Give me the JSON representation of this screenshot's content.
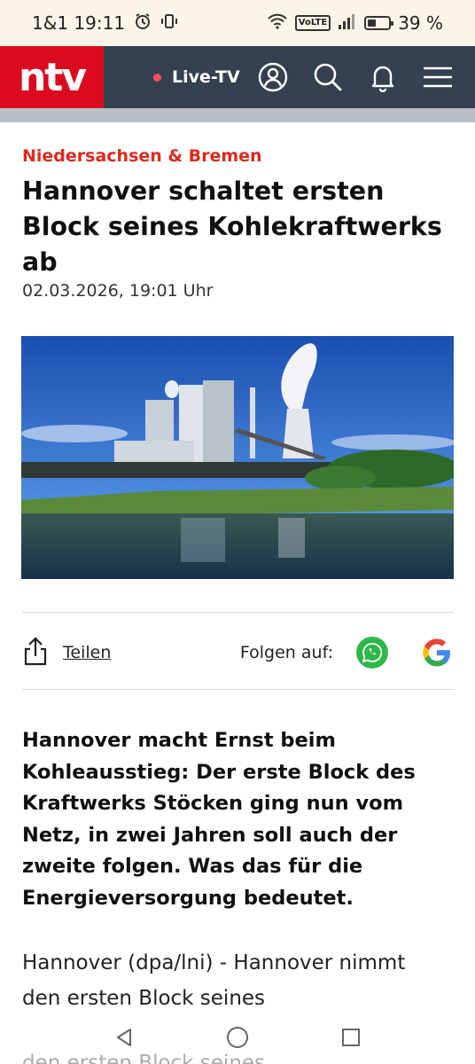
{
  "status": {
    "carrier_time": "1&1 19:11",
    "volte": "VoLTE",
    "battery": "39 %",
    "battery_level": 0.39
  },
  "header": {
    "logo": "ntv",
    "live_label": "Live-TV",
    "icons": [
      "account-icon",
      "search-icon",
      "bell-icon",
      "menu-icon"
    ]
  },
  "article": {
    "kicker": "Niedersachsen & Bremen",
    "headline": "Hannover schaltet ersten Block seines Kohlekraftwerks ab",
    "date": "02.03.2026, 19:01 Uhr",
    "share_label": "Teilen",
    "follow_label": "Folgen auf:",
    "lead": "Hannover macht Ernst beim Kohleausstieg: Der erste Block des Kraftwerks Stöcken ging nun vom Netz, in zwei Jahren soll auch der zweite folgen. Was das für die Energieversorgung bedeutet.",
    "body": "Hannover (dpa/lni) - Hannover nimmt den ersten Block seines",
    "body_ghost": "den ersten Block seines"
  },
  "colors": {
    "brand_red": "#dc0a1e",
    "header_bg": "#344150",
    "kicker": "#dc2a1e",
    "whatsapp": "#2fb84a"
  }
}
